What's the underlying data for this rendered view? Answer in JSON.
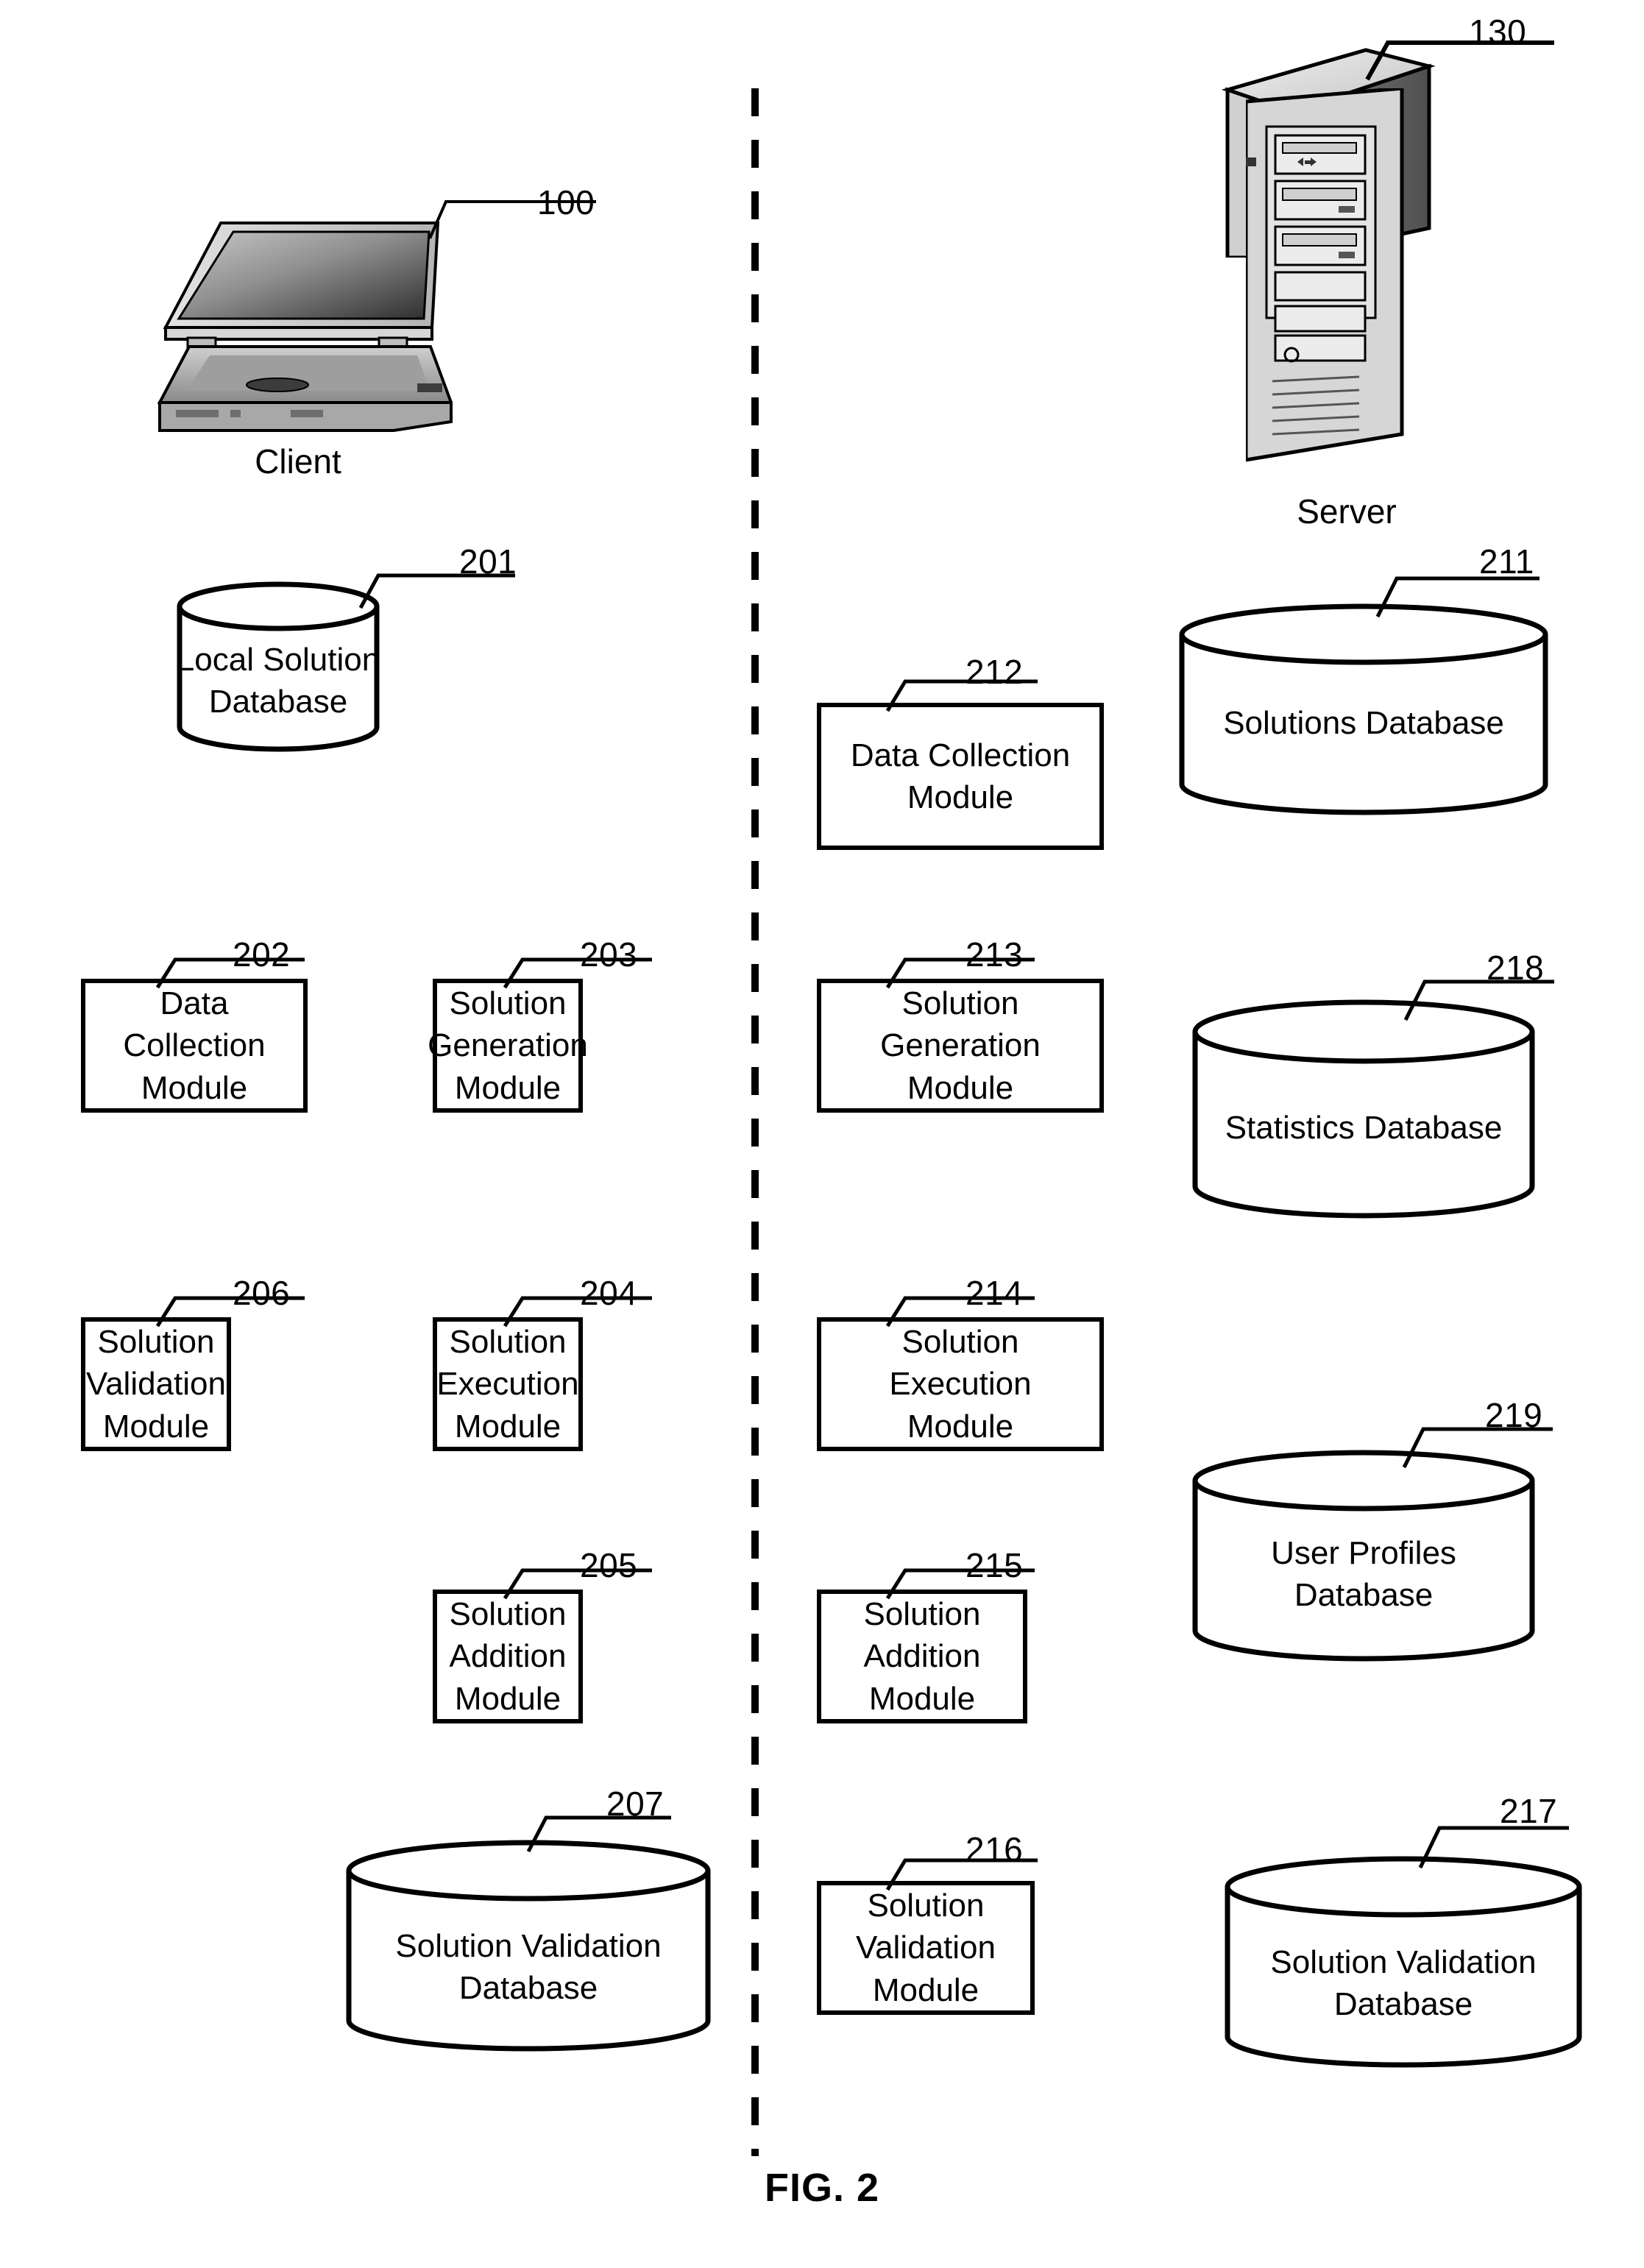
{
  "figure": {
    "caption": "FIG. 2"
  },
  "devices": [
    {
      "id": "client",
      "caption": "Client",
      "ref": "100"
    },
    {
      "id": "server",
      "caption": "Server",
      "ref": "130"
    }
  ],
  "client_column": {
    "databases": [
      {
        "ref": "201",
        "label": "Local Solution\nDatabase"
      },
      {
        "ref": "207",
        "label": "Solution Validation\nDatabase"
      }
    ],
    "modules": [
      {
        "ref": "202",
        "label": "Data Collection\nModule"
      },
      {
        "ref": "203",
        "label": "Solution\nGeneration\nModule"
      },
      {
        "ref": "206",
        "label": "Solution\nValidation\nModule"
      },
      {
        "ref": "204",
        "label": "Solution\nExecution\nModule"
      },
      {
        "ref": "205",
        "label": "Solution\nAddition\nModule"
      }
    ]
  },
  "server_module_column": {
    "modules": [
      {
        "ref": "212",
        "label": "Data Collection\nModule"
      },
      {
        "ref": "213",
        "label": "Solution\nGeneration\nModule"
      },
      {
        "ref": "214",
        "label": "Solution\nExecution\nModule"
      },
      {
        "ref": "215",
        "label": "Solution\nAddition\nModule"
      },
      {
        "ref": "216",
        "label": "Solution\nValidation\nModule"
      }
    ]
  },
  "server_database_column": {
    "databases": [
      {
        "ref": "211",
        "label": "Solutions Database"
      },
      {
        "ref": "218",
        "label": "Statistics Database"
      },
      {
        "ref": "219",
        "label": "User Profiles\nDatabase"
      },
      {
        "ref": "217",
        "label": "Solution Validation\nDatabase"
      }
    ]
  },
  "divider": {
    "style": "dashed-vertical",
    "meaning": "client-server boundary"
  },
  "colors": {
    "ink": "#000000",
    "paper": "#ffffff"
  }
}
